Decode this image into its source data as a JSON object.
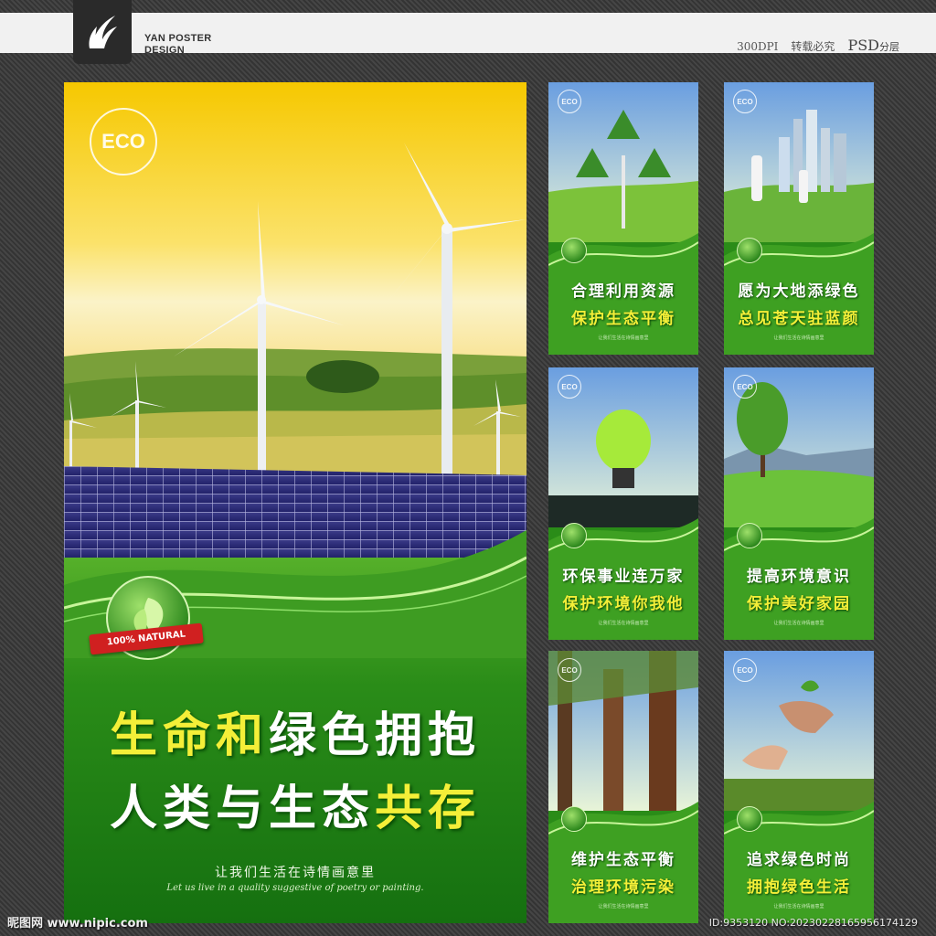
{
  "header": {
    "brand_line1": "YAN POSTER",
    "brand_line2": "DESIGN",
    "dpi": "300DPI",
    "reprint": "转载必究",
    "psd": "PSD",
    "layered": "分层"
  },
  "main_poster": {
    "eco_logo": "ECO",
    "badge_text": "100% NATURAL",
    "line1_part1": "生命和",
    "line1_part2": "绿色拥抱",
    "line2_part1": "人类与生态",
    "line2_part2": "共存",
    "subtitle": "让我们生活在诗情画意里",
    "subtitle_en": "Let us live in a quality suggestive of poetry or painting."
  },
  "small_posters": [
    {
      "eco": "ECO",
      "line1": "合理利用资源",
      "line2": "保护生态平衡",
      "tiny": "让我们生活在诗情画意里",
      "scene": "recycle",
      "sky": "#6a9ee0"
    },
    {
      "eco": "ECO",
      "line1": "愿为大地添绿色",
      "line2": "总见苍天驻蓝颜",
      "tiny": "让我们生活在诗情画意里",
      "scene": "city",
      "sky": "#7fbde8"
    },
    {
      "eco": "ECO",
      "line1": "环保事业连万家",
      "line2": "保护环境你我他",
      "tiny": "让我们生活在诗情画意里",
      "scene": "bulb",
      "sky": "#2a3a34"
    },
    {
      "eco": "ECO",
      "line1": "提高环境意识",
      "line2": "保护美好家园",
      "tiny": "让我们生活在诗情画意里",
      "scene": "tree",
      "sky": "#8cc4ec"
    },
    {
      "eco": "ECO",
      "line1": "维护生态平衡",
      "line2": "治理环境污染",
      "tiny": "让我们生活在诗情画意里",
      "scene": "forest",
      "sky": "#b8d88a"
    },
    {
      "eco": "ECO",
      "line1": "追求绿色时尚",
      "line2": "拥抱绿色生活",
      "tiny": "让我们生活在诗情画意里",
      "scene": "hands",
      "sky": "#a8c878"
    }
  ],
  "footer": {
    "watermark": "昵图网 www.nipic.com",
    "id_text": "ID:9353120 NO:20230228165956174129"
  },
  "colors": {
    "accent_green": "#2a8c18",
    "slogan_yellow": "#f4ef38"
  }
}
